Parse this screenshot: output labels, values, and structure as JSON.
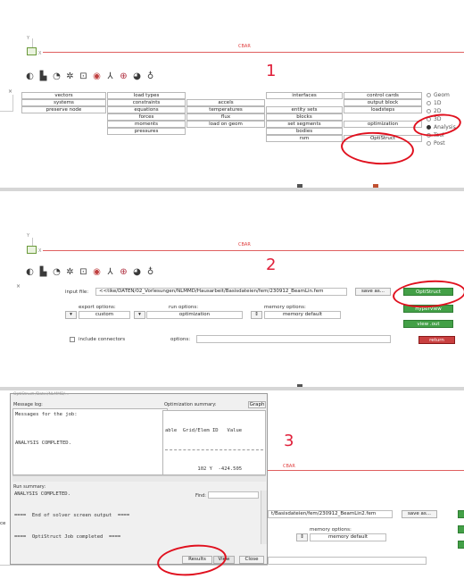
{
  "colors": {
    "annotation_red": "#e0101e",
    "green_button": "#43a047",
    "red_button": "#c94040"
  },
  "panel1": {
    "axis_label": "Y",
    "x_label": "X",
    "cbar": "CBAR",
    "step_number": "1",
    "close_x": "×",
    "toolbar_icons": [
      "sphere-icon",
      "tank-icon",
      "dolly-icon",
      "star-icon",
      "pin-icon",
      "target-icon",
      "axes-icon",
      "magnifier-icon",
      "page-icon",
      "bottle-icon"
    ],
    "grid": [
      [
        "vectors",
        "load types",
        "",
        "",
        "interfaces",
        "control cards"
      ],
      [
        "systems",
        "constraints",
        "accels",
        "",
        "",
        "output block"
      ],
      [
        "preserve node",
        "equations",
        "temperatures",
        "entity sets",
        "loadsteps",
        ""
      ],
      [
        "",
        "forces",
        "flux",
        "blocks",
        "",
        ""
      ],
      [
        "",
        "moments",
        "load on geom",
        "set segments",
        "optimization",
        ""
      ],
      [
        "",
        "pressures",
        "",
        "bodies",
        "",
        ""
      ],
      [
        "",
        "",
        "",
        "rsm",
        "OptiStruct",
        ""
      ]
    ],
    "radios": [
      {
        "label": "Geom",
        "on": false
      },
      {
        "label": "1D",
        "on": false
      },
      {
        "label": "2D",
        "on": false
      },
      {
        "label": "3D",
        "on": false
      },
      {
        "label": "Analysis",
        "on": true
      },
      {
        "label": "Tool",
        "on": false
      },
      {
        "label": "Post",
        "on": false
      }
    ]
  },
  "panel2": {
    "axis_label": "Y",
    "x_label": "X",
    "cbar": "CBAR",
    "step_number": "2",
    "close_x": "×",
    "input_label": "input file:",
    "input_value": "<<tike/DATEN/02_Vorlesungen/NLMMD/Hausarbeit/Basisdateien/fem/230912_BeamLin.fem",
    "save_as": "save as...",
    "export_label": "export options:",
    "export_value": "custom",
    "run_label": "run options:",
    "run_value": "optimization",
    "memory_label": "memory options:",
    "memory_value": "memory default",
    "include_connectors": "include connectors",
    "options_label": "options:",
    "buttons": {
      "optistruct": "OptiStruct",
      "hyperview": "HyperView",
      "view_out": "view .out",
      "return": "return"
    }
  },
  "panel3": {
    "step_number": "3",
    "cbar": "CBAR",
    "path_fragment": "t/Basisdateien/fem/230912_BeamLin2.fem",
    "save_as": "save as...",
    "memory_label": "memory options:",
    "memory_value": "memory default",
    "left_fragment": "ce",
    "window": {
      "title_fragment": "OptiStruct  /Datei/NLMMD/...",
      "message_log_label": "Message log:",
      "message_log_text": "Messages for the job:\n\n\n\nANALYSIS COMPLETED.",
      "opt_summary_label": "Optimization summary:",
      "graph_button": "Graph",
      "opt_header": "able  Grid/Elem ID   Value",
      "opt_row": "           102 Y  -424.505",
      "run_summary_label": "Run summary:",
      "find_label": "Find:",
      "run_summary_text": "ANALYSIS COMPLETED.\n\n\n====  End of solver screen output  ====\n\n\n====  OptiStruct Job completed  ====",
      "results_button": "Results",
      "view_button": "View",
      "close_button": "Close"
    }
  }
}
